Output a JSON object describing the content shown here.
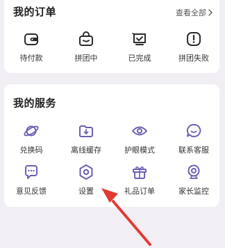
{
  "orders": {
    "title": "我的订单",
    "view_all": "查看全部",
    "items": [
      {
        "label": "待付款",
        "icon": "wallet-icon"
      },
      {
        "label": "拼团中",
        "icon": "group-bag-icon"
      },
      {
        "label": "已完成",
        "icon": "completed-box-icon"
      },
      {
        "label": "拼团失败",
        "icon": "failed-alert-icon"
      }
    ]
  },
  "services": {
    "title": "我的服务",
    "items": [
      {
        "label": "兑换码",
        "icon": "planet-icon"
      },
      {
        "label": "离线缓存",
        "icon": "download-folder-icon"
      },
      {
        "label": "护眼模式",
        "icon": "eye-icon"
      },
      {
        "label": "联系客服",
        "icon": "chat-smile-icon"
      },
      {
        "label": "意见反馈",
        "icon": "feedback-bubble-icon"
      },
      {
        "label": "设置",
        "icon": "settings-hexagon-icon"
      },
      {
        "label": "礼品订单",
        "icon": "gift-box-icon"
      },
      {
        "label": "家长监控",
        "icon": "camera-monitor-icon"
      }
    ]
  },
  "colors": {
    "accent": "#6a5fb5",
    "annotation_arrow": "#e23a32",
    "background": "#f1eef4"
  }
}
